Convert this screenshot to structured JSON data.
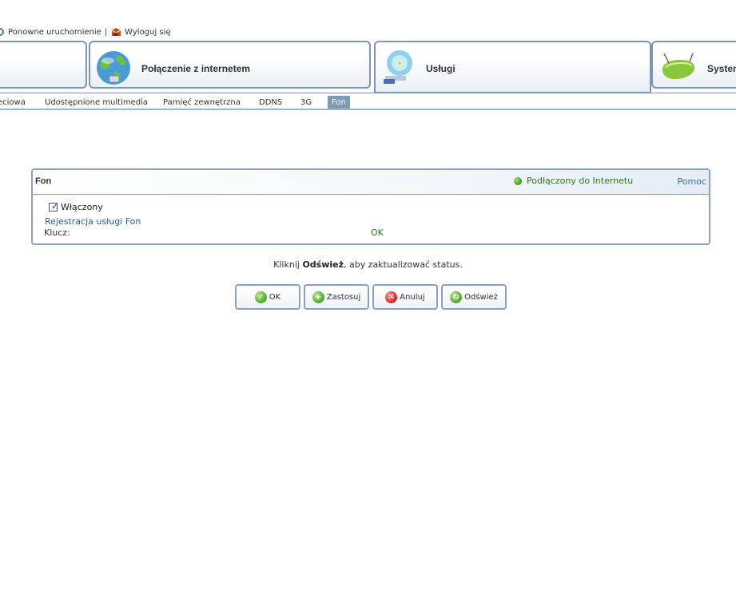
{
  "toplinks": {
    "reboot": "Ponowne uruchomienie",
    "separator": "|",
    "logout": "Wyloguj się"
  },
  "main_tabs": [
    {
      "label": "",
      "icon": "network-icon"
    },
    {
      "label": "Połączenie z internetem",
      "icon": "globe-icon"
    },
    {
      "label": "Usługi",
      "icon": "services-disc-icon",
      "active": true
    },
    {
      "label": "System",
      "icon": "system-router-icon"
    }
  ],
  "sub_tabs": [
    {
      "label": "eciowa"
    },
    {
      "label": "Udostępnione multimedia"
    },
    {
      "label": "Pamięć zewnętrzna"
    },
    {
      "label": "DDNS"
    },
    {
      "label": "3G"
    },
    {
      "label": "Fon",
      "active": true
    }
  ],
  "panel": {
    "title": "Fon",
    "status": "Podłączony do Internetu",
    "help": "Pomoc",
    "enabled_label": "Włączony",
    "enabled_checked": true,
    "register_link": "Rejestracja usługi Fon",
    "key_label": "Klucz:",
    "key_value": "OK"
  },
  "hint": {
    "before": "Kliknij ",
    "bold": "Odśwież",
    "after": ", aby zaktualizować status."
  },
  "buttons": {
    "ok": "OK",
    "apply": "Zastosuj",
    "cancel": "Anuluj",
    "refresh": "Odśwież"
  },
  "colors": {
    "border": "#7d96b3",
    "active_subtab": "#7f99b8",
    "status_green": "#2c7a1c",
    "link_blue": "#2c5f91"
  }
}
